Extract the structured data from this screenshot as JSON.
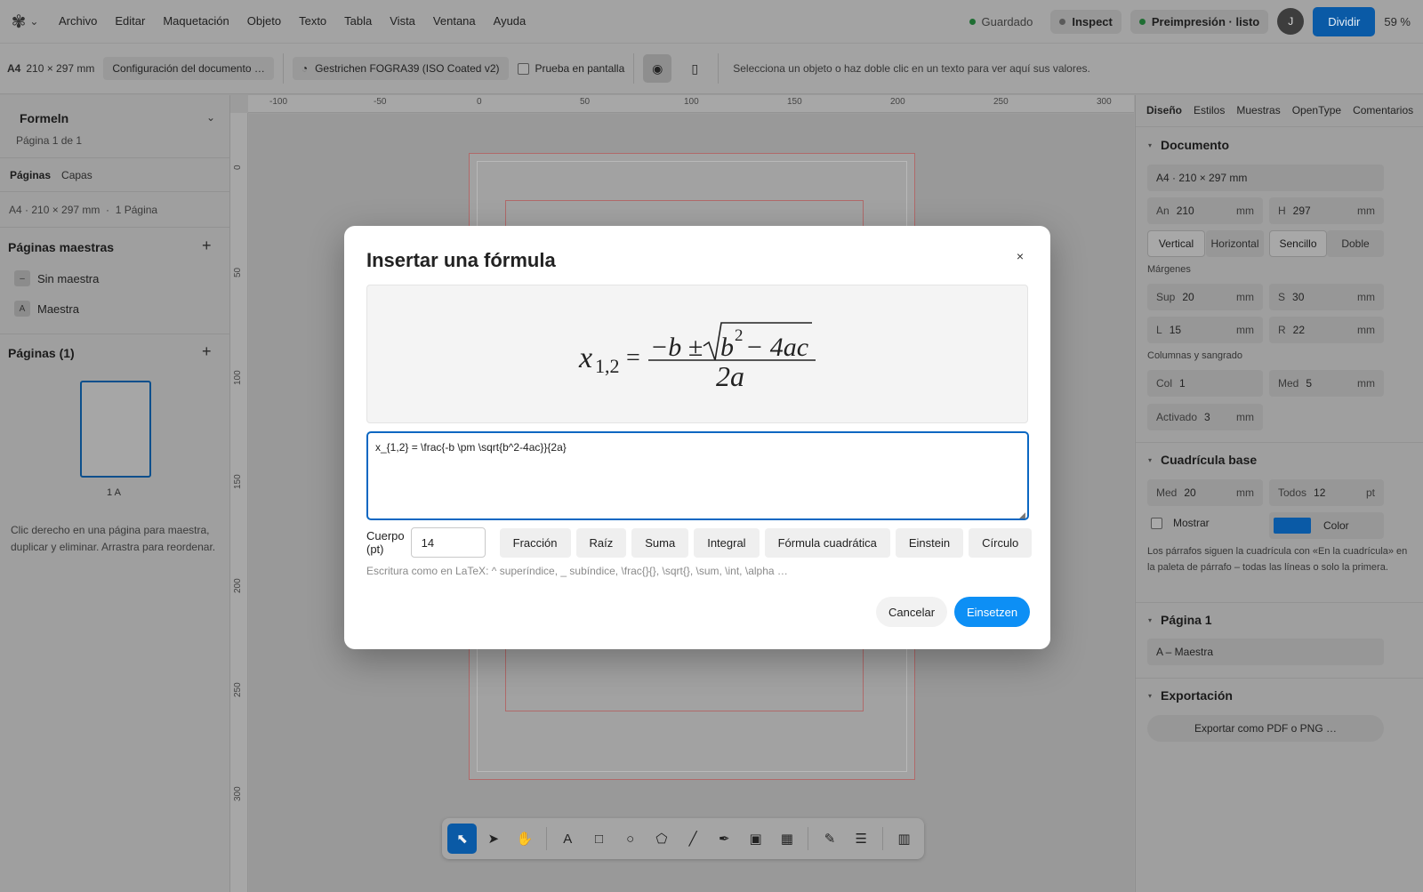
{
  "menubar": {
    "items": [
      "Archivo",
      "Editar",
      "Maquetación",
      "Objeto",
      "Texto",
      "Tabla",
      "Vista",
      "Ventana",
      "Ayuda"
    ],
    "saved": "Guardado",
    "inspect": "Inspect",
    "preflight": "Preimpresión · listo",
    "avatar": "J",
    "share": "Dividir",
    "zoom": "59 %"
  },
  "toolbar": {
    "format": "A4",
    "size": "210 × 297 mm",
    "doc_setup": "Configuración del documento …",
    "profile": "Gestrichen FOGRA39 (ISO Coated v2)",
    "soft_proof": "Prueba en pantalla",
    "hint": "Selecciona un objeto o haz doble clic en un texto para ver aquí sus valores."
  },
  "left_panel": {
    "doc_title": "Formeln",
    "page_info": "Página 1 de 1",
    "tabs": [
      "Páginas",
      "Capas"
    ],
    "doc_meta": "A4 · 210 × 297 mm  ·  1 Página",
    "masters_title": "Páginas maestras",
    "masters": [
      {
        "badge": "–",
        "label": "Sin maestra"
      },
      {
        "badge": "A",
        "label": "Maestra"
      }
    ],
    "pages_title": "Páginas (1)",
    "thumb_label": "1 A",
    "help": "Clic derecho en una página para maestra, duplicar y eliminar. Arrastra para reordenar."
  },
  "rulers": {
    "top": [
      "-100",
      "-50",
      "0",
      "50",
      "100",
      "150",
      "200",
      "250",
      "300"
    ],
    "left": [
      "0",
      "50",
      "100",
      "150",
      "200",
      "250",
      "300"
    ]
  },
  "right_panel": {
    "tabs": [
      "Diseño",
      "Estilos",
      "Muestras",
      "OpenType",
      "Comentarios"
    ],
    "document": {
      "title": "Documento",
      "format": "A4 · 210 × 297 mm",
      "width_label": "An",
      "width": "210",
      "height_label": "H",
      "height": "297",
      "unit": "mm",
      "orient": [
        "Vertical",
        "Horizontal"
      ],
      "sides": [
        "Sencillo",
        "Doble"
      ],
      "margins_label": "Márgenes",
      "m_top_label": "Sup",
      "m_top": "20",
      "m_s_label": "S",
      "m_s": "30",
      "m_l_label": "L",
      "m_l": "15",
      "m_r_label": "R",
      "m_r": "22",
      "cols_label": "Columnas y sangrado",
      "col_label": "Col",
      "col": "1",
      "gap_label": "Med",
      "gap": "5",
      "bleed_label": "Activado",
      "bleed": "3"
    },
    "grid": {
      "title": "Cuadrícula base",
      "med_label": "Med",
      "med": "20",
      "all_label": "Todos",
      "all": "12",
      "pt": "pt",
      "show": "Mostrar",
      "color": "Color",
      "color_value": "#0a5aa6",
      "note": "Los párrafos siguen la cuadrícula con «En la cuadrícula» en la paleta de párrafo – todas las líneas o solo la primera."
    },
    "page": {
      "title": "Página 1",
      "master": "A – Maestra"
    },
    "export": {
      "title": "Exportación",
      "button": "Exportar como PDF o PNG …"
    }
  },
  "modal": {
    "title": "Insertar una fórmula",
    "close": "×",
    "preview": {
      "lhs_var": "x",
      "lhs_sub": "1,2",
      "equals": "=",
      "num_pre": "−b ± ",
      "radicand_b": "b",
      "radicand_exp": "2",
      "radicand_rest": " − 4ac",
      "denominator": "2a"
    },
    "source": "x_{1,2} = \\frac{-b \\pm \\sqrt{b^2-4ac}}{2a}",
    "size_label": "Cuerpo (pt)",
    "size_value": "14",
    "presets": [
      "Fracción",
      "Raíz",
      "Suma",
      "Integral",
      "Fórmula cuadrática",
      "Einstein",
      "Círculo"
    ],
    "help": "Escritura como en LaTeX: ^ superíndice, _ subíndice, \\frac{}{}, \\sqrt{}, \\sum, \\int, \\alpha …",
    "cancel": "Cancelar",
    "confirm": "Einsetzen"
  },
  "colors": {
    "accent": "#0d8ff5",
    "focus": "#0b67c2",
    "saved_dot": "#1a8a3a"
  }
}
